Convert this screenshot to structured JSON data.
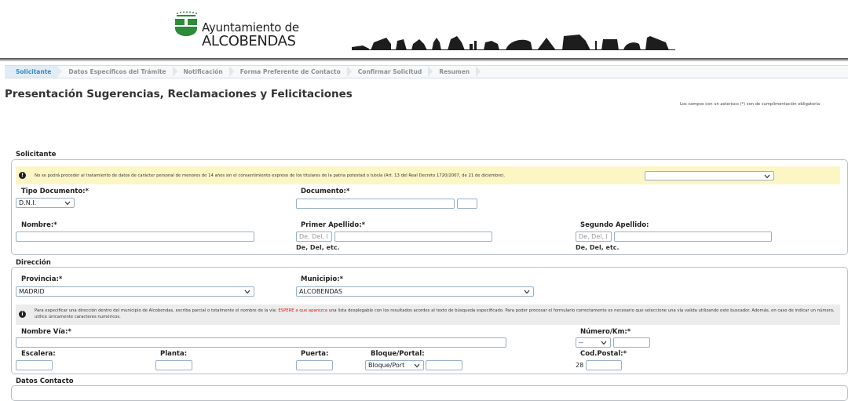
{
  "header": {
    "logo_line1": "Ayuntamiento de",
    "logo_line2": "ALCOBENDAS",
    "colors": {
      "logo_green": "#2e8b3a",
      "rule": "#5a5a5a"
    }
  },
  "steps": [
    {
      "label": "Solicitante",
      "active": true
    },
    {
      "label": "Datos Específicos del Trámite",
      "active": false
    },
    {
      "label": "Notificación",
      "active": false
    },
    {
      "label": "Forma Preferente de Contacto",
      "active": false
    },
    {
      "label": "Confirmar Solicitud",
      "active": false
    },
    {
      "label": "Resumen",
      "active": false
    }
  ],
  "page_title": "Presentación Sugerencias, Reclamaciones y Felicitaciones",
  "required_note": "Los campos con un asterisco (*) son de cumplimentación obligatoria",
  "solicitante": {
    "title": "Solicitante",
    "warning": "No se podrá proceder al tratamiento de datos de carácter personal de menores de 14 años sin el consentimiento expreso de los titulares de la patria potestad o tutela (Art. 13 del Real Decreto 1720/2007, de 21 de diciembre).",
    "tipo_documento_label": "Tipo Documento:*",
    "tipo_documento_value": "D.N.I.",
    "documento_label": "Documento:*",
    "nombre_label": "Nombre:*",
    "primer_apellido_label": "Primer Apellido:*",
    "segundo_apellido_label": "Segundo Apellido:",
    "particle_placeholder": "De, Del, l",
    "particle_help": "De, Del, etc."
  },
  "direccion": {
    "title": "Dirección",
    "provincia_label": "Provincia:*",
    "provincia_value": "MADRID",
    "municipio_label": "Municipio:*",
    "municipio_value": "ALCOBENDAS",
    "info_part1": "Para especificar una dirección dentro del municipio de Alcobendas, escriba parcial o totalmente el nombre de la vía: ",
    "info_highlight": "ESPERE a que aparezca",
    "info_part2": " una lista desplegable con los resultados acordes al texto de búsqueda especificado. Para poder procesar el formulario correctamente es necesario que seleccione una vía valida utilizando este buscador. Además, en caso de indicar un número, utilice únicamente caracteres numéricos.",
    "nombre_via_label": "Nombre Vía:*",
    "numero_label": "Número/Km:*",
    "numero_select_value": "--",
    "escalera_label": "Escalera:",
    "planta_label": "Planta:",
    "puerta_label": "Puerta:",
    "bloque_label": "Bloque/Portal:",
    "bloque_select_value": "Bloque/Port",
    "cod_postal_label": "Cod.Postal:*",
    "cod_postal_prefix": "28"
  },
  "datos_contacto": {
    "title": "Datos Contacto"
  }
}
